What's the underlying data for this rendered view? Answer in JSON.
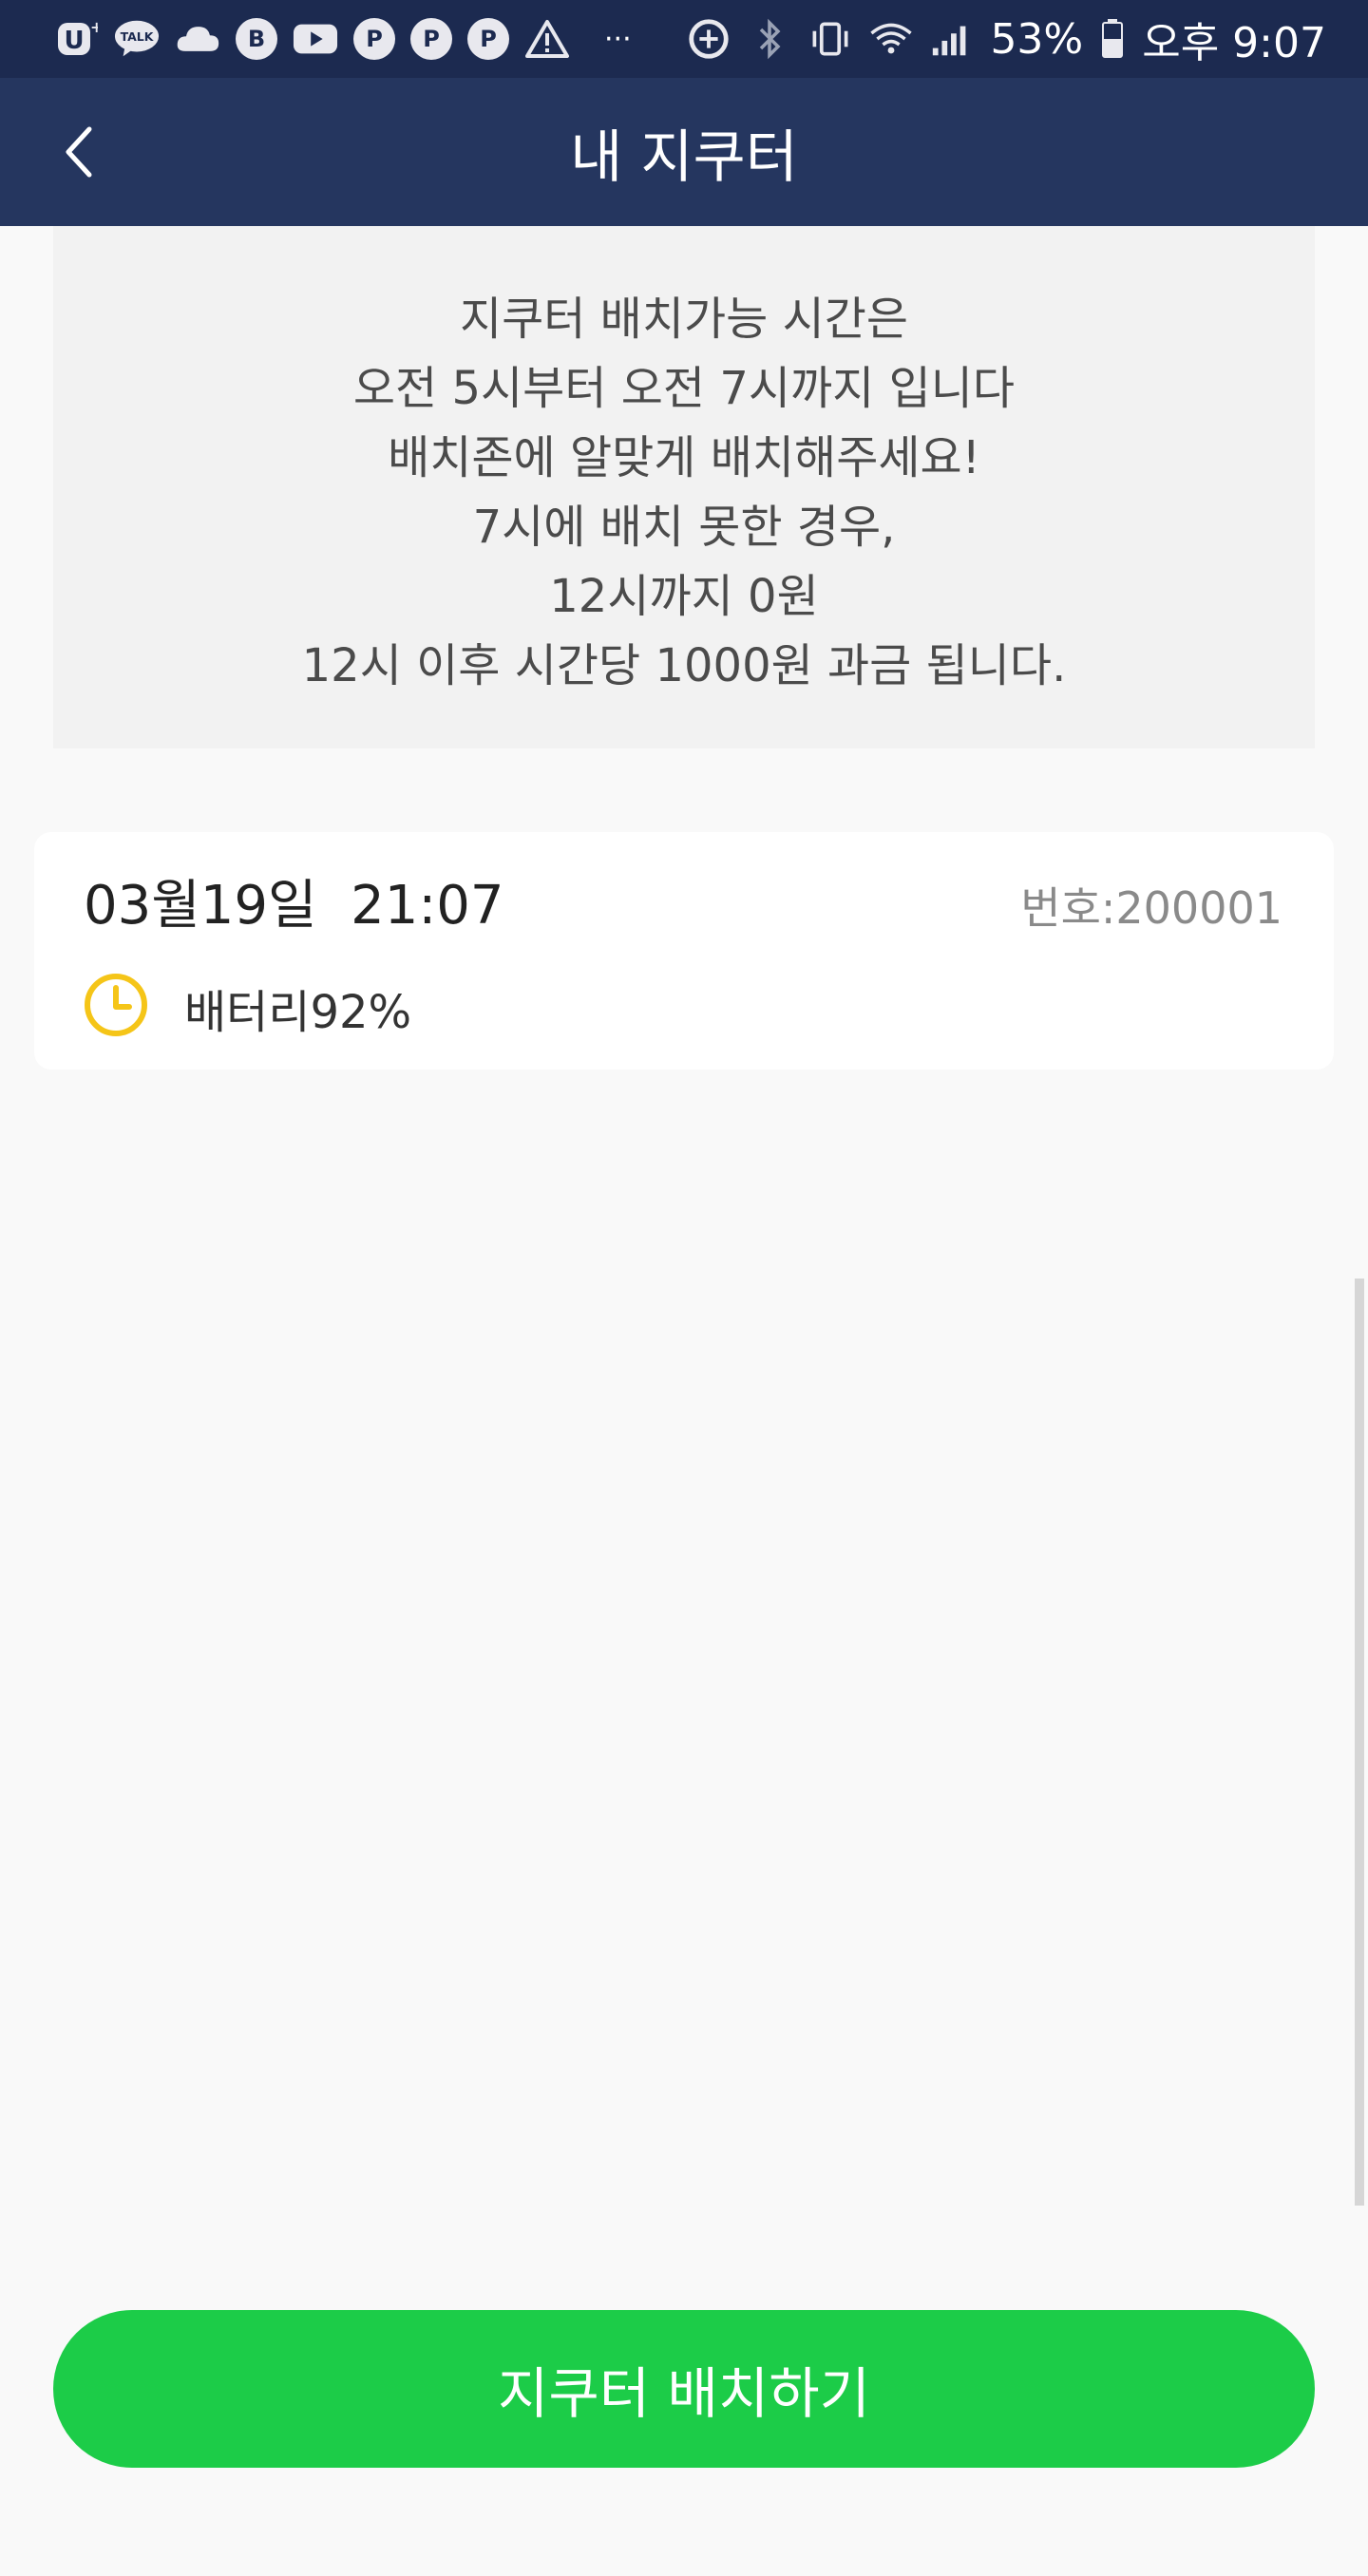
{
  "status_bar": {
    "left_icons": [
      "u-plus-icon",
      "talk-icon",
      "cloud-icon",
      "b-icon",
      "youtube-icon",
      "p-icon",
      "p-icon",
      "p-icon",
      "warning-icon",
      "more-icon"
    ],
    "talk_label": "TALK",
    "b_label": "B",
    "p_label": "P",
    "dots": "···",
    "battery_percent": "53%",
    "time": "오후 9:07"
  },
  "header": {
    "title": "내 지쿠터"
  },
  "notice": {
    "lines": [
      "지쿠터 배치가능 시간은",
      "오전 5시부터 오전 7시까지 입니다",
      "배치존에 알맞게 배치해주세요!",
      "7시에 배치 못한 경우,",
      "12시까지 0원",
      "12시 이후 시간당 1000원 과금 됩니다."
    ]
  },
  "scooter_card": {
    "date_time": "03월19일  21:07",
    "number": "번호:200001",
    "battery": "배터리92%"
  },
  "colors": {
    "status_bar_bg": "#1c2a50",
    "header_bg": "#25365f",
    "accent_green": "#1ccc48",
    "clock_yellow": "#f5c518"
  },
  "action_button": {
    "label": "지쿠터 배치하기"
  }
}
